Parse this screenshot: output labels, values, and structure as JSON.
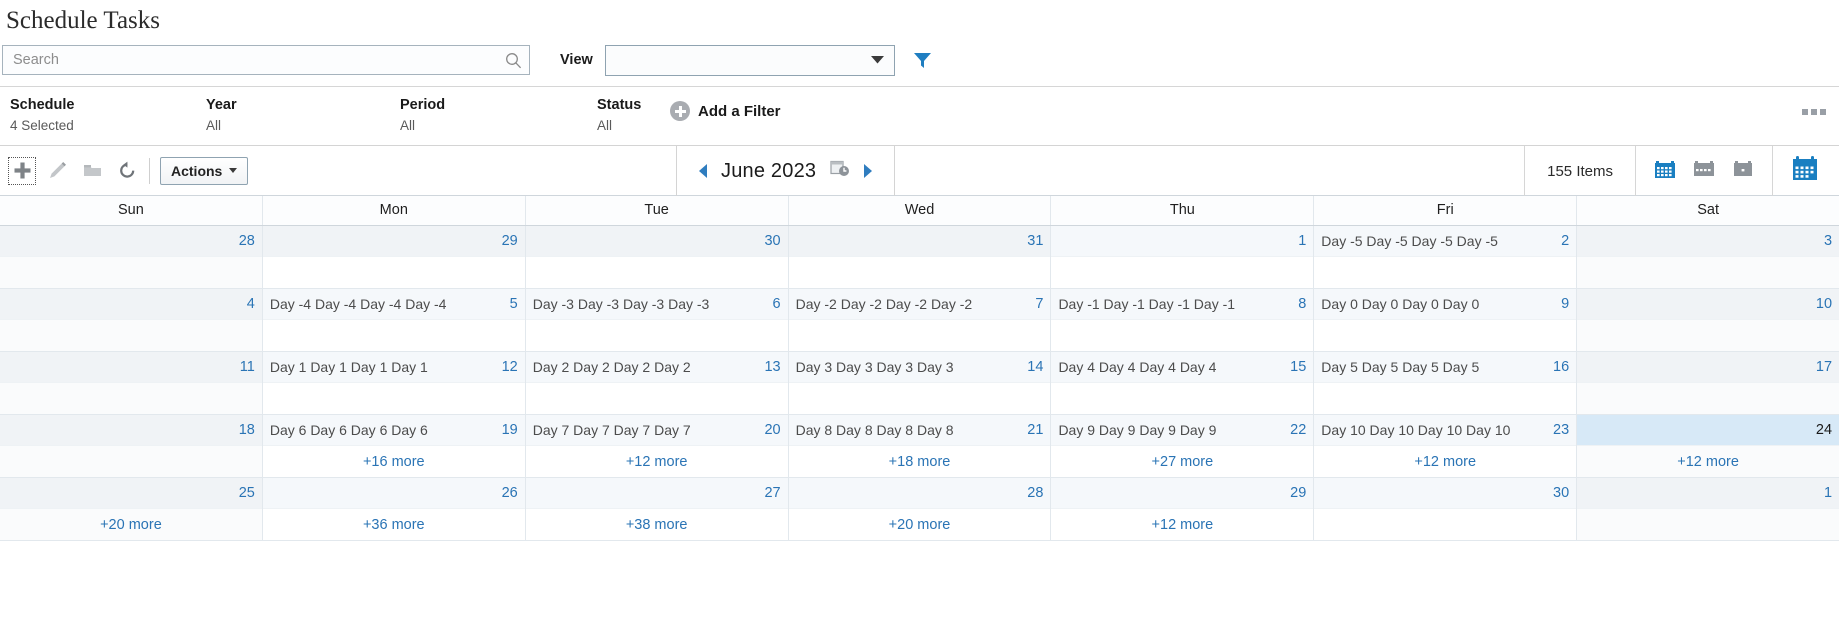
{
  "header": {
    "title": "Schedule Tasks"
  },
  "search": {
    "placeholder": "Search",
    "value": "",
    "icon": "search-icon"
  },
  "view": {
    "label": "View",
    "value": "",
    "options": [],
    "filter_icon": "funnel-icon"
  },
  "filters": {
    "items": [
      {
        "label": "Schedule",
        "value": "4 Selected"
      },
      {
        "label": "Year",
        "value": "All"
      },
      {
        "label": "Period",
        "value": "All"
      },
      {
        "label": "Status",
        "value": "All"
      }
    ],
    "add_filter_label": "Add a Filter",
    "overflow_icon": "kebab-menu-icon"
  },
  "toolbar": {
    "icons": [
      {
        "name": "add-icon",
        "glyph": "plus"
      },
      {
        "name": "edit-icon",
        "glyph": "pencil"
      },
      {
        "name": "folder-icon",
        "glyph": "folder"
      },
      {
        "name": "refresh-icon",
        "glyph": "refresh"
      }
    ],
    "actions_label": "Actions",
    "prev_label": "Previous period",
    "next_label": "Next period",
    "month_label": "June 2023",
    "goto_date_icon": "calendar-clock-icon",
    "items_count": "155 Items",
    "view_buttons": [
      {
        "name": "month-view-icon",
        "state": "selected"
      },
      {
        "name": "week-view-icon",
        "state": "normal"
      },
      {
        "name": "day-view-icon",
        "state": "normal"
      },
      {
        "name": "agenda-calendar-icon",
        "state": "accent"
      }
    ]
  },
  "calendar": {
    "weekday_headers": [
      "Sun",
      "Mon",
      "Tue",
      "Wed",
      "Thu",
      "Fri",
      "Sat"
    ],
    "weeks": [
      {
        "days": [
          {
            "num": "28",
            "event": "",
            "more": "",
            "othermonth": true,
            "weekend": true,
            "today": false
          },
          {
            "num": "29",
            "event": "",
            "more": "",
            "othermonth": true,
            "weekend": false,
            "today": false
          },
          {
            "num": "30",
            "event": "",
            "more": "",
            "othermonth": true,
            "weekend": false,
            "today": false
          },
          {
            "num": "31",
            "event": "",
            "more": "",
            "othermonth": true,
            "weekend": false,
            "today": false
          },
          {
            "num": "1",
            "event": "",
            "more": "",
            "othermonth": false,
            "weekend": false,
            "today": false
          },
          {
            "num": "2",
            "event": "Day -5 Day -5 Day -5 Day -5",
            "more": "",
            "othermonth": false,
            "weekend": false,
            "today": false
          },
          {
            "num": "3",
            "event": "",
            "more": "",
            "othermonth": false,
            "weekend": true,
            "today": false
          }
        ]
      },
      {
        "days": [
          {
            "num": "4",
            "event": "",
            "more": "",
            "othermonth": false,
            "weekend": true,
            "today": false
          },
          {
            "num": "5",
            "event": "Day -4 Day -4 Day -4 Day -4",
            "more": "",
            "othermonth": false,
            "weekend": false,
            "today": false
          },
          {
            "num": "6",
            "event": "Day -3 Day -3 Day -3 Day -3",
            "more": "",
            "othermonth": false,
            "weekend": false,
            "today": false
          },
          {
            "num": "7",
            "event": "Day -2 Day -2 Day -2 Day -2",
            "more": "",
            "othermonth": false,
            "weekend": false,
            "today": false
          },
          {
            "num": "8",
            "event": "Day -1 Day -1 Day -1 Day -1",
            "more": "",
            "othermonth": false,
            "weekend": false,
            "today": false
          },
          {
            "num": "9",
            "event": "Day 0 Day 0 Day 0 Day 0",
            "more": "",
            "othermonth": false,
            "weekend": false,
            "today": false
          },
          {
            "num": "10",
            "event": "",
            "more": "",
            "othermonth": false,
            "weekend": true,
            "today": false
          }
        ]
      },
      {
        "days": [
          {
            "num": "11",
            "event": "",
            "more": "",
            "othermonth": false,
            "weekend": true,
            "today": false
          },
          {
            "num": "12",
            "event": "Day 1 Day 1 Day 1 Day 1",
            "more": "",
            "othermonth": false,
            "weekend": false,
            "today": false
          },
          {
            "num": "13",
            "event": "Day 2 Day 2 Day 2 Day 2",
            "more": "",
            "othermonth": false,
            "weekend": false,
            "today": false
          },
          {
            "num": "14",
            "event": "Day 3 Day 3 Day 3 Day 3",
            "more": "",
            "othermonth": false,
            "weekend": false,
            "today": false
          },
          {
            "num": "15",
            "event": "Day 4 Day 4 Day 4 Day 4",
            "more": "",
            "othermonth": false,
            "weekend": false,
            "today": false
          },
          {
            "num": "16",
            "event": "Day 5 Day 5 Day 5 Day 5",
            "more": "",
            "othermonth": false,
            "weekend": false,
            "today": false
          },
          {
            "num": "17",
            "event": "",
            "more": "",
            "othermonth": false,
            "weekend": true,
            "today": false
          }
        ]
      },
      {
        "days": [
          {
            "num": "18",
            "event": "",
            "more": "",
            "othermonth": false,
            "weekend": true,
            "today": false
          },
          {
            "num": "19",
            "event": "Day 6 Day 6 Day 6 Day 6",
            "more": "+16 more",
            "othermonth": false,
            "weekend": false,
            "today": false
          },
          {
            "num": "20",
            "event": "Day 7 Day 7 Day 7 Day 7",
            "more": "+12 more",
            "othermonth": false,
            "weekend": false,
            "today": false
          },
          {
            "num": "21",
            "event": "Day 8 Day 8 Day 8 Day 8",
            "more": "+18 more",
            "othermonth": false,
            "weekend": false,
            "today": false
          },
          {
            "num": "22",
            "event": "Day 9 Day 9 Day 9 Day 9",
            "more": "+27 more",
            "othermonth": false,
            "weekend": false,
            "today": false
          },
          {
            "num": "23",
            "event": "Day 10 Day 10 Day 10 Day 10",
            "more": "+12 more",
            "othermonth": false,
            "weekend": false,
            "today": false
          },
          {
            "num": "24",
            "event": "",
            "more": "+12 more",
            "othermonth": false,
            "weekend": true,
            "today": true
          }
        ]
      },
      {
        "days": [
          {
            "num": "25",
            "event": "",
            "more": "+20 more",
            "othermonth": false,
            "weekend": true,
            "today": false
          },
          {
            "num": "26",
            "event": "",
            "more": "+36 more",
            "othermonth": false,
            "weekend": false,
            "today": false
          },
          {
            "num": "27",
            "event": "",
            "more": "+38 more",
            "othermonth": false,
            "weekend": false,
            "today": false
          },
          {
            "num": "28",
            "event": "",
            "more": "+20 more",
            "othermonth": false,
            "weekend": false,
            "today": false
          },
          {
            "num": "29",
            "event": "",
            "more": "+12 more",
            "othermonth": false,
            "weekend": false,
            "today": false
          },
          {
            "num": "30",
            "event": "",
            "more": "",
            "othermonth": false,
            "weekend": false,
            "today": false
          },
          {
            "num": "1",
            "event": "",
            "more": "",
            "othermonth": true,
            "weekend": true,
            "today": false
          }
        ]
      }
    ]
  },
  "colors": {
    "accent": "#2a74b5",
    "link": "#2a74b5",
    "today_bg": "#d7e9f7",
    "header_bg": "#f5f8fb"
  }
}
